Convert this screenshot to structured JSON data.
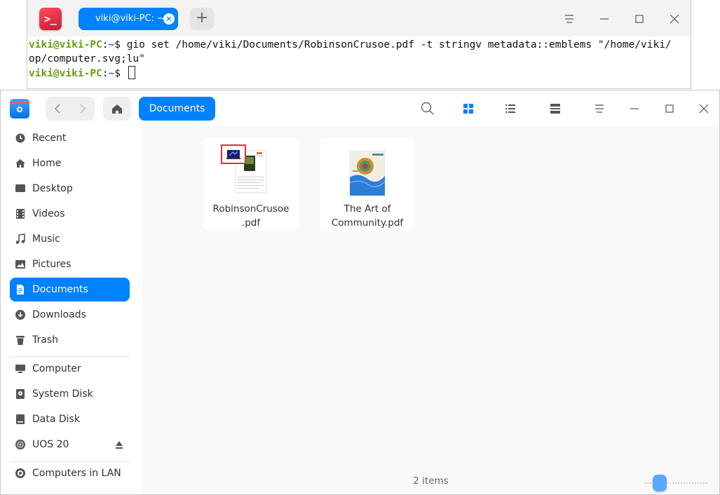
{
  "terminal": {
    "tab_title": "viki@viki-PC: ~",
    "lines": [
      {
        "user": "viki@viki-PC",
        "sep": ":",
        "path": "~",
        "prompt": "$ ",
        "cmd": "gio set /home/viki/Documents/RobinsonCrusoe.pdf -t stringv metadata::emblems \"/home/viki/"
      },
      {
        "cont": "op/computer.svg;lu\""
      },
      {
        "user": "viki@viki-PC",
        "sep": ":",
        "path": "~",
        "prompt": "$ ",
        "cmd": ""
      }
    ]
  },
  "file_manager": {
    "breadcrumb": "Documents",
    "sidebar": {
      "items": [
        {
          "label": "Recent",
          "icon": "clock-icon"
        },
        {
          "label": "Home",
          "icon": "home-icon"
        },
        {
          "label": "Desktop",
          "icon": "desktop-icon"
        },
        {
          "label": "Videos",
          "icon": "video-icon"
        },
        {
          "label": "Music",
          "icon": "music-icon"
        },
        {
          "label": "Pictures",
          "icon": "pictures-icon"
        },
        {
          "label": "Documents",
          "icon": "document-icon",
          "active": true
        },
        {
          "label": "Downloads",
          "icon": "download-icon"
        },
        {
          "label": "Trash",
          "icon": "trash-icon"
        }
      ],
      "devices": [
        {
          "label": "Computer",
          "icon": "computer-icon"
        },
        {
          "label": "System Disk",
          "icon": "disk-icon"
        },
        {
          "label": "Data Disk",
          "icon": "disk-icon"
        },
        {
          "label": "UOS 20",
          "icon": "optical-disc-icon",
          "eject": true
        }
      ],
      "network": [
        {
          "label": "Computers in LAN",
          "icon": "network-icon"
        }
      ]
    },
    "files": [
      {
        "name_line1": "RobinsonCrusoe",
        "name_line2": ".pdf",
        "emblem": "computer-icon"
      },
      {
        "name_line1": "The Art of",
        "name_line2": "Community.pdf"
      }
    ],
    "status": "2 items",
    "colors": {
      "accent": "#0081ff",
      "emblem_border": "#e0303c"
    }
  }
}
